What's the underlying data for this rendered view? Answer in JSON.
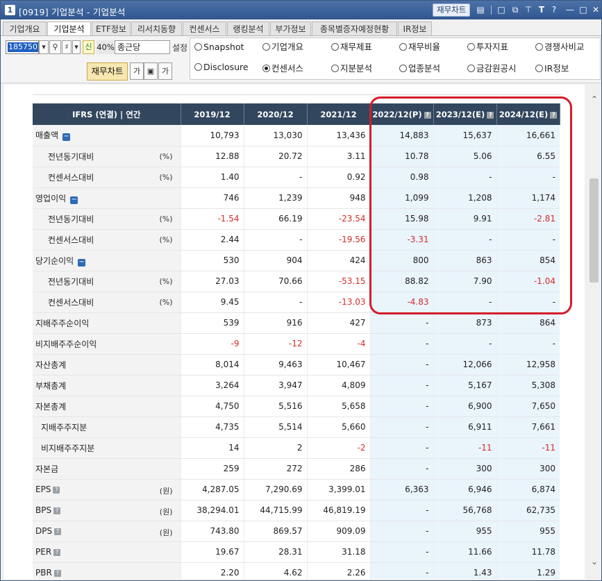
{
  "window": {
    "number": "1",
    "title": "[0919] 기업분석 - 기업분석",
    "fin_chart_btn": "재무차트"
  },
  "tabs": [
    "기업개요",
    "기업분석",
    "ETF정보",
    "리서치동향",
    "컨센서스",
    "랭킹분석",
    "부가정보",
    "종목별증자예정현황",
    "IR정보"
  ],
  "active_tab": "기업분석",
  "toolbar": {
    "code": "185750",
    "new_label": "신",
    "zoom": "40%",
    "size_select": "종근당",
    "settings_label": "설정",
    "fin_chart_label": "재무차트",
    "small1": "가",
    "small3": "가"
  },
  "radios": [
    {
      "label": "Snapshot",
      "checked": false
    },
    {
      "label": "기업개요",
      "checked": false
    },
    {
      "label": "재무제표",
      "checked": false
    },
    {
      "label": "재무비율",
      "checked": false
    },
    {
      "label": "투자지표",
      "checked": false
    },
    {
      "label": "경쟁사비교",
      "checked": false
    },
    {
      "label": "Disclosure",
      "checked": false
    },
    {
      "label": "컨센서스",
      "checked": true
    },
    {
      "label": "지분분석",
      "checked": false
    },
    {
      "label": "업종분석",
      "checked": false
    },
    {
      "label": "금감원공시",
      "checked": false
    },
    {
      "label": "IR정보",
      "checked": false
    }
  ],
  "table": {
    "header_label": "IFRS (연결) | 연간",
    "years": [
      "2019/12",
      "2020/12",
      "2021/12",
      "2022/12(P)",
      "2023/12(E)",
      "2024/12(E)"
    ],
    "rows": [
      {
        "label": "매출액",
        "unit": "",
        "indent": 0,
        "expand": true,
        "q": false,
        "values": [
          "10,793",
          "13,030",
          "13,436",
          "14,883",
          "15,637",
          "16,661"
        ]
      },
      {
        "label": "전년동기대비",
        "unit": "(%)",
        "indent": 2,
        "expand": false,
        "q": false,
        "values": [
          "12.88",
          "20.72",
          "3.11",
          "10.78",
          "5.06",
          "6.55"
        ]
      },
      {
        "label": "컨센서스대비",
        "unit": "(%)",
        "indent": 2,
        "expand": false,
        "q": false,
        "values": [
          "1.40",
          "-",
          "0.92",
          "0.98",
          "-",
          "-"
        ]
      },
      {
        "label": "영업이익",
        "unit": "",
        "indent": 0,
        "expand": true,
        "q": false,
        "values": [
          "746",
          "1,239",
          "948",
          "1,099",
          "1,208",
          "1,174"
        ]
      },
      {
        "label": "전년동기대비",
        "unit": "(%)",
        "indent": 2,
        "expand": false,
        "q": false,
        "values": [
          "-1.54",
          "66.19",
          "-23.54",
          "15.98",
          "9.91",
          "-2.81"
        ]
      },
      {
        "label": "컨센서스대비",
        "unit": "(%)",
        "indent": 2,
        "expand": false,
        "q": false,
        "values": [
          "2.44",
          "-",
          "-19.56",
          "-3.31",
          "-",
          "-"
        ]
      },
      {
        "label": "당기순이익",
        "unit": "",
        "indent": 0,
        "expand": true,
        "q": false,
        "values": [
          "530",
          "904",
          "424",
          "800",
          "863",
          "854"
        ]
      },
      {
        "label": "전년동기대비",
        "unit": "(%)",
        "indent": 2,
        "expand": false,
        "q": false,
        "values": [
          "27.03",
          "70.66",
          "-53.15",
          "88.82",
          "7.90",
          "-1.04"
        ]
      },
      {
        "label": "컨센서스대비",
        "unit": "(%)",
        "indent": 2,
        "expand": false,
        "q": false,
        "values": [
          "9.45",
          "-",
          "-13.03",
          "-4.83",
          "-",
          "-"
        ]
      },
      {
        "label": "지배주주순이익",
        "unit": "",
        "indent": 0,
        "expand": false,
        "q": false,
        "values": [
          "539",
          "916",
          "427",
          "-",
          "873",
          "864"
        ]
      },
      {
        "label": "비지배주주순이익",
        "unit": "",
        "indent": 0,
        "expand": false,
        "q": false,
        "values": [
          "-9",
          "-12",
          "-4",
          "-",
          "-",
          "-"
        ]
      },
      {
        "label": "자산총계",
        "unit": "",
        "indent": 0,
        "expand": false,
        "q": false,
        "values": [
          "8,014",
          "9,463",
          "10,467",
          "-",
          "12,066",
          "12,958"
        ]
      },
      {
        "label": "부채총계",
        "unit": "",
        "indent": 0,
        "expand": false,
        "q": false,
        "values": [
          "3,264",
          "3,947",
          "4,809",
          "-",
          "5,167",
          "5,308"
        ]
      },
      {
        "label": "자본총계",
        "unit": "",
        "indent": 0,
        "expand": false,
        "q": false,
        "values": [
          "4,750",
          "5,516",
          "5,658",
          "-",
          "6,900",
          "7,650"
        ]
      },
      {
        "label": "지배주주지분",
        "unit": "",
        "indent": 1,
        "expand": false,
        "q": false,
        "values": [
          "4,735",
          "5,514",
          "5,660",
          "-",
          "6,911",
          "7,661"
        ]
      },
      {
        "label": "비지배주주지분",
        "unit": "",
        "indent": 1,
        "expand": false,
        "q": false,
        "values": [
          "14",
          "2",
          "-2",
          "-",
          "-11",
          "-11"
        ]
      },
      {
        "label": "자본금",
        "unit": "",
        "indent": 0,
        "expand": false,
        "q": false,
        "values": [
          "259",
          "272",
          "286",
          "-",
          "300",
          "300"
        ]
      },
      {
        "label": "EPS",
        "unit": "(원)",
        "indent": 0,
        "expand": false,
        "q": true,
        "values": [
          "4,287.05",
          "7,290.69",
          "3,399.01",
          "6,363",
          "6,946",
          "6,874"
        ]
      },
      {
        "label": "BPS",
        "unit": "(원)",
        "indent": 0,
        "expand": false,
        "q": true,
        "values": [
          "38,294.01",
          "44,715.99",
          "46,819.19",
          "-",
          "56,768",
          "62,735"
        ]
      },
      {
        "label": "DPS",
        "unit": "(원)",
        "indent": 0,
        "expand": false,
        "q": true,
        "values": [
          "743.80",
          "869.57",
          "909.09",
          "-",
          "955",
          "955"
        ]
      },
      {
        "label": "PER",
        "unit": "",
        "indent": 0,
        "expand": false,
        "q": true,
        "values": [
          "19.67",
          "28.31",
          "31.18",
          "-",
          "11.66",
          "11.78"
        ]
      },
      {
        "label": "PBR",
        "unit": "",
        "indent": 0,
        "expand": false,
        "q": true,
        "values": [
          "2.20",
          "4.62",
          "2.26",
          "-",
          "1.43",
          "1.29"
        ]
      }
    ]
  },
  "colors": {
    "header_bg": "#32465e",
    "estimate_bg": "#e9f4fb",
    "negative": "#d52b2b",
    "highlight_border": "#d31c2a"
  }
}
